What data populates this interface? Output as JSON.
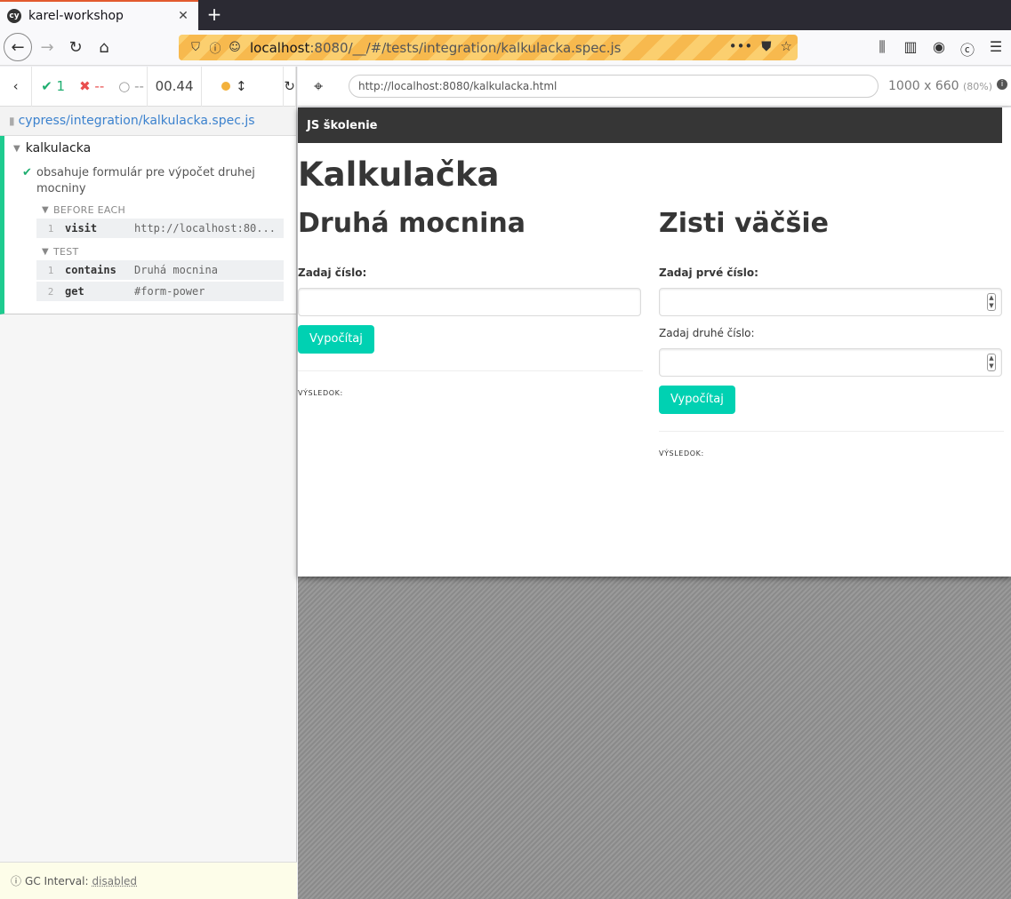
{
  "browser": {
    "tab_title": "karel-workshop",
    "tab_favicon": "cy",
    "url_host": "localhost",
    "url_rest": ":8080/__/#/tests/integration/kalkulacka.spec.js"
  },
  "reporter": {
    "stats": {
      "passed": "1",
      "failed": "--",
      "pending": "--",
      "duration": "00.44"
    },
    "spec_path": "cypress/integration/kalkulacka.spec.js",
    "suite": "kalkulacka",
    "test": "obsahuje formulár pre výpočet druhej mocniny",
    "before_each_label": "BEFORE EACH",
    "test_label": "TEST",
    "before_each_commands": [
      {
        "num": "1",
        "name": "visit",
        "message": "http://localhost:80..."
      }
    ],
    "test_commands": [
      {
        "num": "1",
        "name": "contains",
        "message": "Druhá mocnina"
      },
      {
        "num": "2",
        "name": "get",
        "message": "#form-power"
      }
    ],
    "gc_label": "GC Interval:",
    "gc_value": "disabled"
  },
  "aut": {
    "url": "http://localhost:8080/kalkulacka.html",
    "size": "1000 x 660",
    "scale": "(80%)"
  },
  "app": {
    "nav_title": "JS školenie",
    "title": "Kalkulačka",
    "left": {
      "heading": "Druhá mocnina",
      "label": "Zadaj číslo:",
      "button": "Vypočítaj",
      "result": "VÝSLEDOK:"
    },
    "right": {
      "heading": "Zisti väčšie",
      "label_first": "Zadaj prvé číslo:",
      "label_second": "Zadaj druhé číslo:",
      "button": "Vypočítaj",
      "result": "VÝSLEDOK:"
    }
  },
  "colors": {
    "pass": "#1fae70",
    "fail": "#e94f4f",
    "accent": "#00d1b2",
    "running": "#f3b13b"
  }
}
